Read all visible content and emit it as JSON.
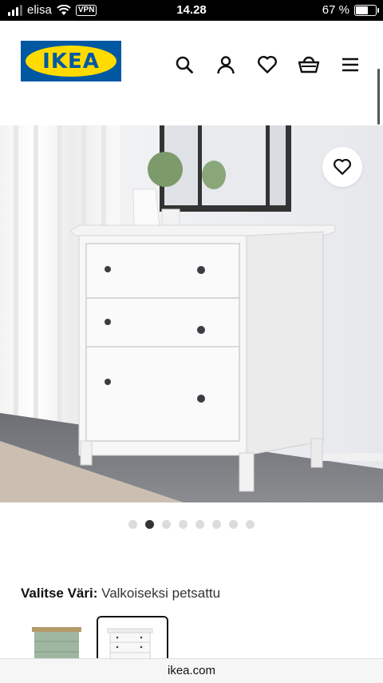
{
  "status": {
    "carrier": "elisa",
    "vpn": "VPN",
    "time": "14.28",
    "battery": "67 %",
    "battery_level": 0.67
  },
  "header": {
    "logo_text": "IKEA",
    "icons": [
      "search-icon",
      "user-icon",
      "heart-icon",
      "basket-icon",
      "menu-icon"
    ],
    "brand_blue": "#0058a3",
    "brand_yellow": "#ffdb00"
  },
  "gallery": {
    "dots_total": 8,
    "active_index": 1,
    "favorite_icon": "heart-icon"
  },
  "color_select": {
    "label": "Valitse Väri:",
    "value": "Valkoiseksi petsattu",
    "swatches": [
      {
        "name": "grey-green",
        "selected": false
      },
      {
        "name": "white-stain",
        "selected": true
      }
    ]
  },
  "browser": {
    "url": "ikea.com"
  }
}
